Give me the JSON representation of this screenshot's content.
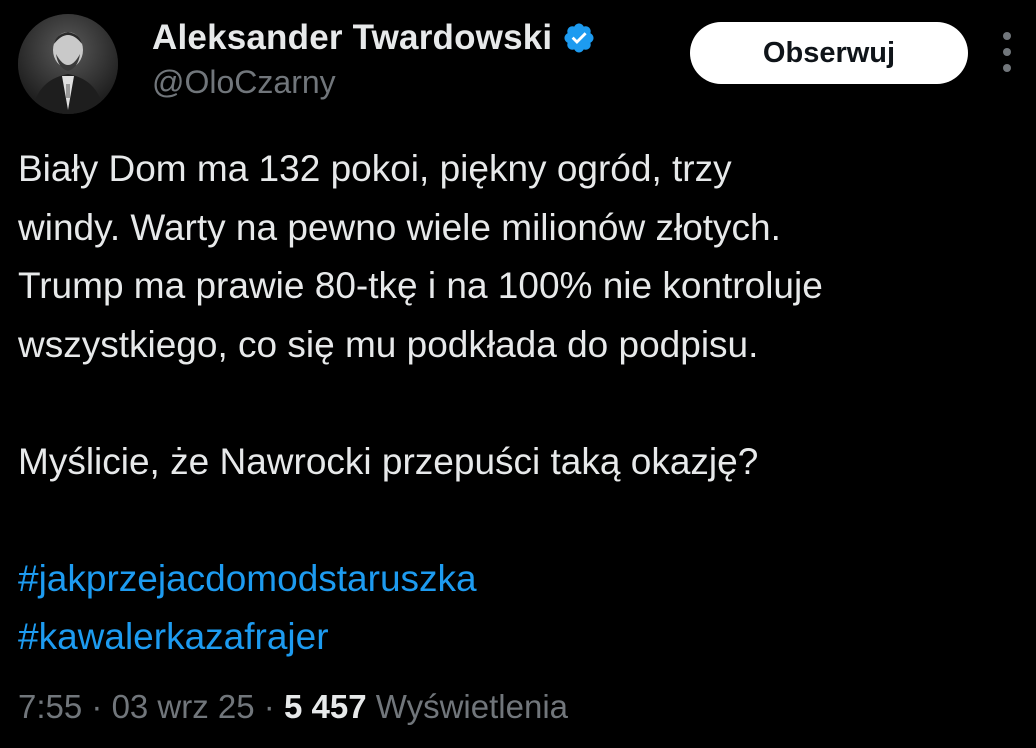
{
  "author": {
    "display_name": "Aleksander Twardowski",
    "handle": "@OloCzarny",
    "verified": true,
    "verified_color": "#1d9bf0"
  },
  "actions": {
    "follow_label": "Obserwuj",
    "more_icon": "more-vertical-icon"
  },
  "tweet": {
    "lines": [
      "Biały Dom ma 132 pokoi, piękny ogród, trzy",
      "windy. Warty na pewno wiele milionów złotych.",
      "Trump ma prawie 80-tkę i na 100% nie kontroluje",
      "wszystkiego, co się mu podkłada do podpisu.",
      "Myślicie, że Nawrocki przepuści taką okazję?"
    ],
    "hashtags": [
      "#jakprzejacdomodstaruszka",
      "#kawalerkazafrajer"
    ],
    "hashtag_color": "#1d9bf0"
  },
  "meta": {
    "time": "7:55",
    "separator": " · ",
    "date": "03 wrz 25",
    "views_count": "5 457",
    "views_label": "Wyświetlenia"
  }
}
